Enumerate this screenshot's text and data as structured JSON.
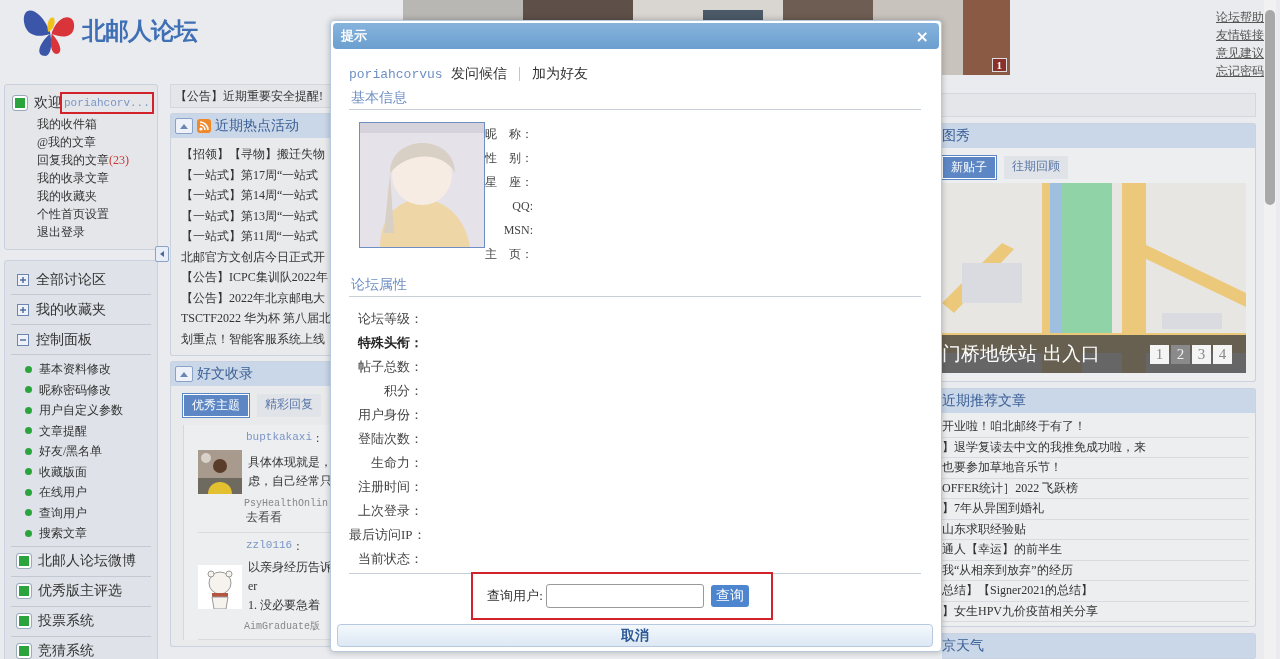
{
  "header": {
    "logo_text": "北邮人论坛",
    "banner": {
      "page": "1"
    },
    "links": [
      "论坛帮助",
      "友情链接",
      "意见建议",
      "忘记密码"
    ]
  },
  "welcome": {
    "greeting": "欢迎",
    "username": "poriahcorv...",
    "highlighted": true,
    "items": [
      {
        "label": "我的收件箱"
      },
      {
        "label": "@我的文章"
      },
      {
        "label": "回复我的文章",
        "count": "(23)"
      },
      {
        "label": "我的收录文章"
      },
      {
        "label": "我的收藏夹"
      },
      {
        "label": "个性首页设置"
      },
      {
        "label": "退出登录"
      }
    ]
  },
  "nav": [
    {
      "label": "全部讨论区",
      "kind": "folder",
      "expanded": false
    },
    {
      "label": "我的收藏夹",
      "kind": "folder",
      "expanded": false
    },
    {
      "label": "控制面板",
      "kind": "folder",
      "expanded": true,
      "children": [
        "基本资料修改",
        "昵称密码修改",
        "用户自定义参数",
        "文章提醒",
        "好友/黑名单",
        "收藏版面",
        "在线用户",
        "查询用户",
        "搜索文章"
      ]
    },
    {
      "label": "北邮人论坛微博",
      "kind": "link"
    },
    {
      "label": "优秀版主评选",
      "kind": "link"
    },
    {
      "label": "投票系统",
      "kind": "link"
    },
    {
      "label": "竞猜系统",
      "kind": "link"
    }
  ],
  "middle": {
    "notice": "【公告】近期重要安全提醒!",
    "hot": {
      "title": "近期热点活动",
      "items": [
        "【招领】【寻物】搬迁失物",
        "【一站式】第17周“一站式",
        "【一站式】第14周“一站式",
        "【一站式】第13周“一站式",
        "【一站式】第11周“一站式",
        "北邮官方文创店今日正式开",
        "【公告】ICPC集训队2022年",
        "【公告】2022年北京邮电大",
        "TSCTF2022 华为杯 第八届北",
        "划重点！智能客服系统上线"
      ]
    },
    "picks": {
      "title": "好文收录",
      "tabs": [
        {
          "label": "优秀主题",
          "selected": true
        },
        {
          "label": "精彩回复",
          "selected": false
        }
      ],
      "posts": [
        {
          "author": "buptkakaxi",
          "sep": ":",
          "lines": [
            "具体体现就是，",
            "虑，自己经常只"
          ],
          "board": "PsyHealthOnlin",
          "footer": "去看看"
        },
        {
          "author": "zzl0116",
          "sep": ":",
          "lines": [
            "以亲身经历告诉",
            "er",
            "1. 没必要急着"
          ],
          "board": "AimGraduate版"
        }
      ]
    }
  },
  "dialog": {
    "title": "提示",
    "close": "×",
    "user": "poriahcorvus",
    "actions": [
      "发问候信",
      "加为好友"
    ],
    "basic_title": "基本信息",
    "basic_fields": [
      "昵　称：",
      "性　别：",
      "星　座：",
      "QQ:",
      "MSN:",
      "主　页："
    ],
    "attr_title": "论坛属性",
    "attr_fields": [
      {
        "label": "论坛等级：",
        "bold": false
      },
      {
        "label": "特殊头衔：",
        "bold": true
      },
      {
        "label": "帖子总数：",
        "bold": false
      },
      {
        "label": "积分：",
        "bold": false
      },
      {
        "label": "用户身份：",
        "bold": false
      },
      {
        "label": "登陆次数：",
        "bold": false
      },
      {
        "label": "生命力：",
        "bold": false
      },
      {
        "label": "注册时间：",
        "bold": false
      },
      {
        "label": "上次登录：",
        "bold": false
      },
      {
        "label": "最后访问IP：",
        "bold": false
      },
      {
        "label": "当前状态：",
        "bold": false
      }
    ],
    "query": {
      "label": "查询用户:",
      "button": "查询",
      "highlighted": true
    },
    "cancel": "取消"
  },
  "right": {
    "show_title": "图秀",
    "tabs": [
      {
        "label": "新贴子",
        "selected": true
      },
      {
        "label": "往期回顾",
        "selected": false
      }
    ],
    "slide": {
      "caption": "门桥地铁站 出入口",
      "pages": [
        {
          "label": "1",
          "selected": false
        },
        {
          "label": "2",
          "selected": true
        },
        {
          "label": "3",
          "selected": false
        },
        {
          "label": "4",
          "selected": false
        }
      ]
    },
    "rec_title": "近期推荐文章",
    "rec_items": [
      "开业啦！咱北邮终于有了！",
      "】退学复读去中文的我推免成功啦，来",
      "也要参加草地音乐节！",
      "OFFER统计］2022 飞跃榜",
      "】7年从异国到婚礼",
      "山东求职经验贴",
      "通人【幸运】的前半生",
      "我“从相亲到放弃”的经历",
      "总结】【Signer2021的总结】",
      "】女生HPV九价疫苗相关分享"
    ],
    "weather_title": "京天气"
  }
}
